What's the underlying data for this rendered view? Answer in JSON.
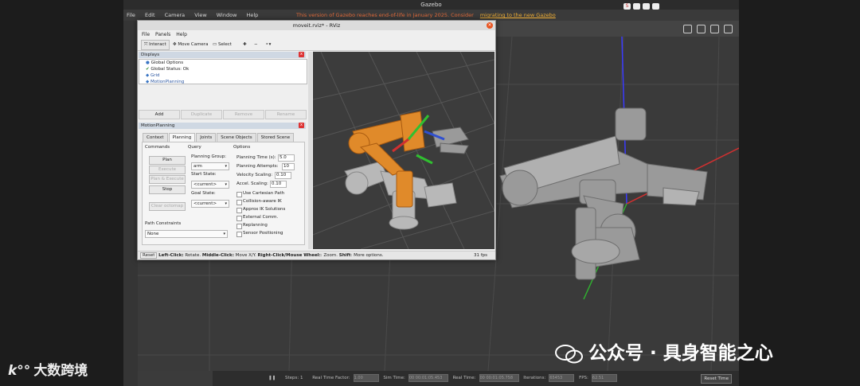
{
  "gazebo": {
    "title": "Gazebo",
    "menu": [
      "File",
      "Edit",
      "Camera",
      "View",
      "Window",
      "Help"
    ],
    "notice_text": "This version of Gazebo reaches end-of-life in January 2025. Consider ",
    "notice_link": "migrating to the new Gazebo",
    "bottom": {
      "steps_label": "Steps: 1",
      "real_time_factor_label": "Real Time Factor:",
      "real_time_factor_value": "1.00",
      "sim_time_label": "Sim Time:",
      "sim_time_value": "00 00:01:05.453",
      "real_time_label": "Real Time:",
      "real_time_value": "00 00:01:05.758",
      "iterations_label": "Iterations:",
      "iterations_value": "65453",
      "fps_label": "FPS:",
      "fps_value": "62.51",
      "reset_time": "Reset Time"
    }
  },
  "rviz": {
    "title": "moveit.rviz* - RViz",
    "menu": [
      "File",
      "Panels",
      "Help"
    ],
    "tools": {
      "interact": "Interact",
      "move_camera": "Move Camera",
      "select": "Select"
    },
    "displays": {
      "title": "Displays",
      "items": [
        "Global Options",
        "Global Status: Ok",
        "Grid",
        "MotionPlanning"
      ]
    },
    "display_buttons": [
      "Add",
      "Duplicate",
      "Remove",
      "Rename"
    ],
    "motion_planning": {
      "title": "MotionPlanning",
      "tabs": [
        "Context",
        "Planning",
        "Joints",
        "Scene Objects",
        "Stored Scene"
      ],
      "commands_label": "Commands",
      "buttons": {
        "plan": "Plan",
        "execute": "Execute",
        "plan_execute": "Plan & Execute",
        "stop": "Stop",
        "clear_octomap": "Clear octomap"
      },
      "query_label": "Query",
      "planning_group_label": "Planning Group:",
      "planning_group_value": "arm",
      "start_state_label": "Start State:",
      "start_state_value": "<current>",
      "goal_state_label": "Goal State:",
      "goal_state_value": "<current>",
      "options_label": "Options",
      "planning_time_label": "Planning Time (s):",
      "planning_time_value": "5.0",
      "planning_attempts_label": "Planning Attempts:",
      "planning_attempts_value": "10",
      "velocity_scaling_label": "Velocity Scaling:",
      "velocity_scaling_value": "0.10",
      "accel_scaling_label": "Accel. Scaling:",
      "accel_scaling_value": "0.10",
      "checkboxes": [
        "Use Cartesian Path",
        "Collision-aware IK",
        "Approx IK Solutions",
        "External Comm.",
        "Replanning",
        "Sensor Positioning"
      ],
      "path_constraints_label": "Path Constraints",
      "path_constraints_value": "None"
    },
    "status": {
      "reset": "Reset",
      "hint_bold1": "Left-Click:",
      "hint1": " Rotate. ",
      "hint_bold2": "Middle-Click:",
      "hint2": " Move X/Y. ",
      "hint_bold3": "Right-Click/Mouse Wheel:",
      "hint3": ": Zoom. ",
      "hint_bold4": "Shift",
      "hint4": ": More options.",
      "fps": "31 fps"
    }
  },
  "watermarks": {
    "left": "大数跨境",
    "right": "公众号 · 具身智能之心"
  },
  "colors": {
    "notice": "#e06a3a",
    "link": "#f2b035",
    "orange_arm": "#e08a2a"
  }
}
